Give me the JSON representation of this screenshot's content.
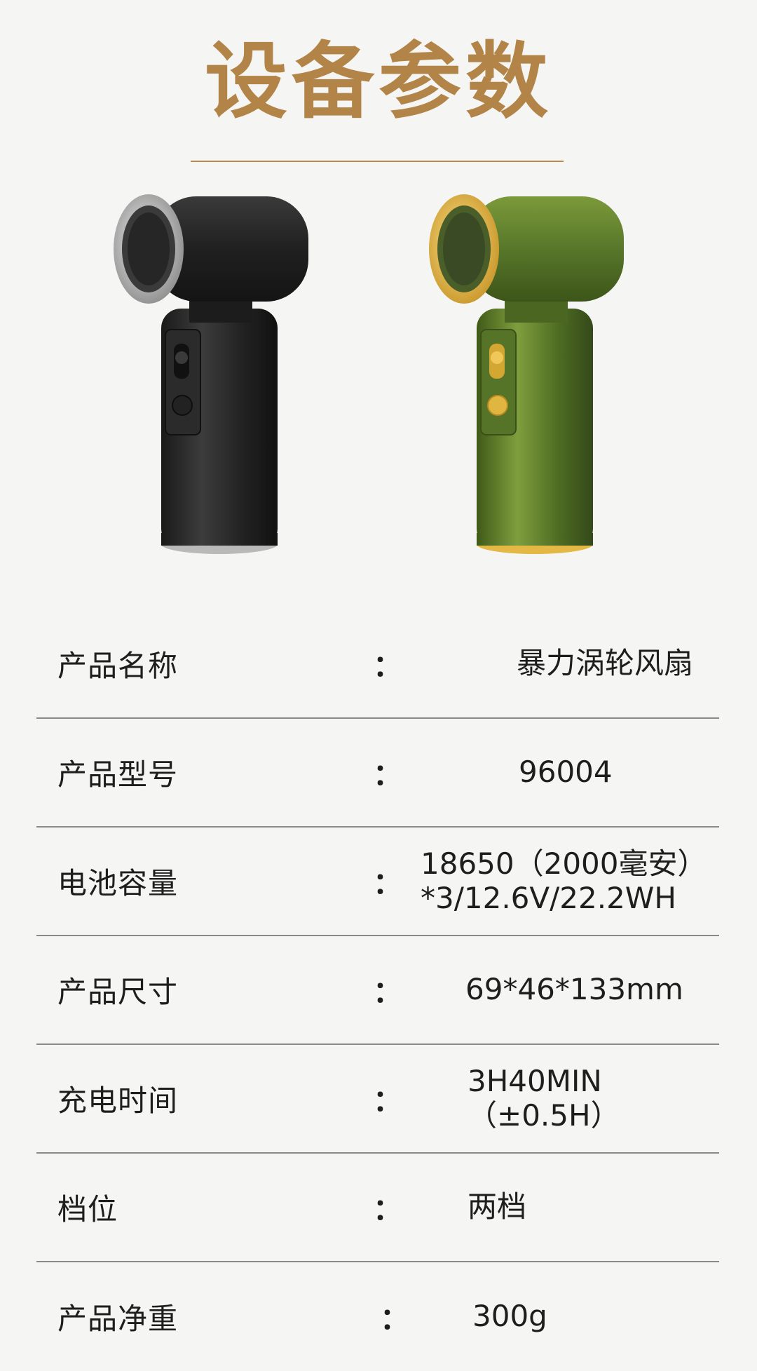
{
  "page": {
    "title": "设备参数"
  },
  "products": [
    {
      "name": "black-fan",
      "body": "#2a2a2a",
      "ring": "#c8c8c8",
      "accent": "#9a9a9a"
    },
    {
      "name": "green-fan",
      "body": "#5e7e2c",
      "ring": "#e0bd4a",
      "accent": "#d4ac3a"
    }
  ],
  "specs": [
    {
      "label": "产品名称",
      "colon": "：",
      "value": [
        "暴力涡轮风扇"
      ]
    },
    {
      "label": "产品型号",
      "colon": "：",
      "value": [
        "96004"
      ]
    },
    {
      "label": "电池容量",
      "colon": "：",
      "value": [
        "18650（2000毫安）",
        "*3/12.6V/22.2WH"
      ]
    },
    {
      "label": "产品尺寸",
      "colon": "：",
      "value": [
        "69*46*133mm"
      ]
    },
    {
      "label": "充电时间",
      "colon": "：",
      "value": [
        "3H40MIN",
        "（±0.5H）"
      ]
    },
    {
      "label": "档位",
      "colon": "：",
      "value": [
        "两档"
      ]
    },
    {
      "label": "产品净重",
      "colon": "：",
      "value": [
        "300g"
      ]
    }
  ]
}
